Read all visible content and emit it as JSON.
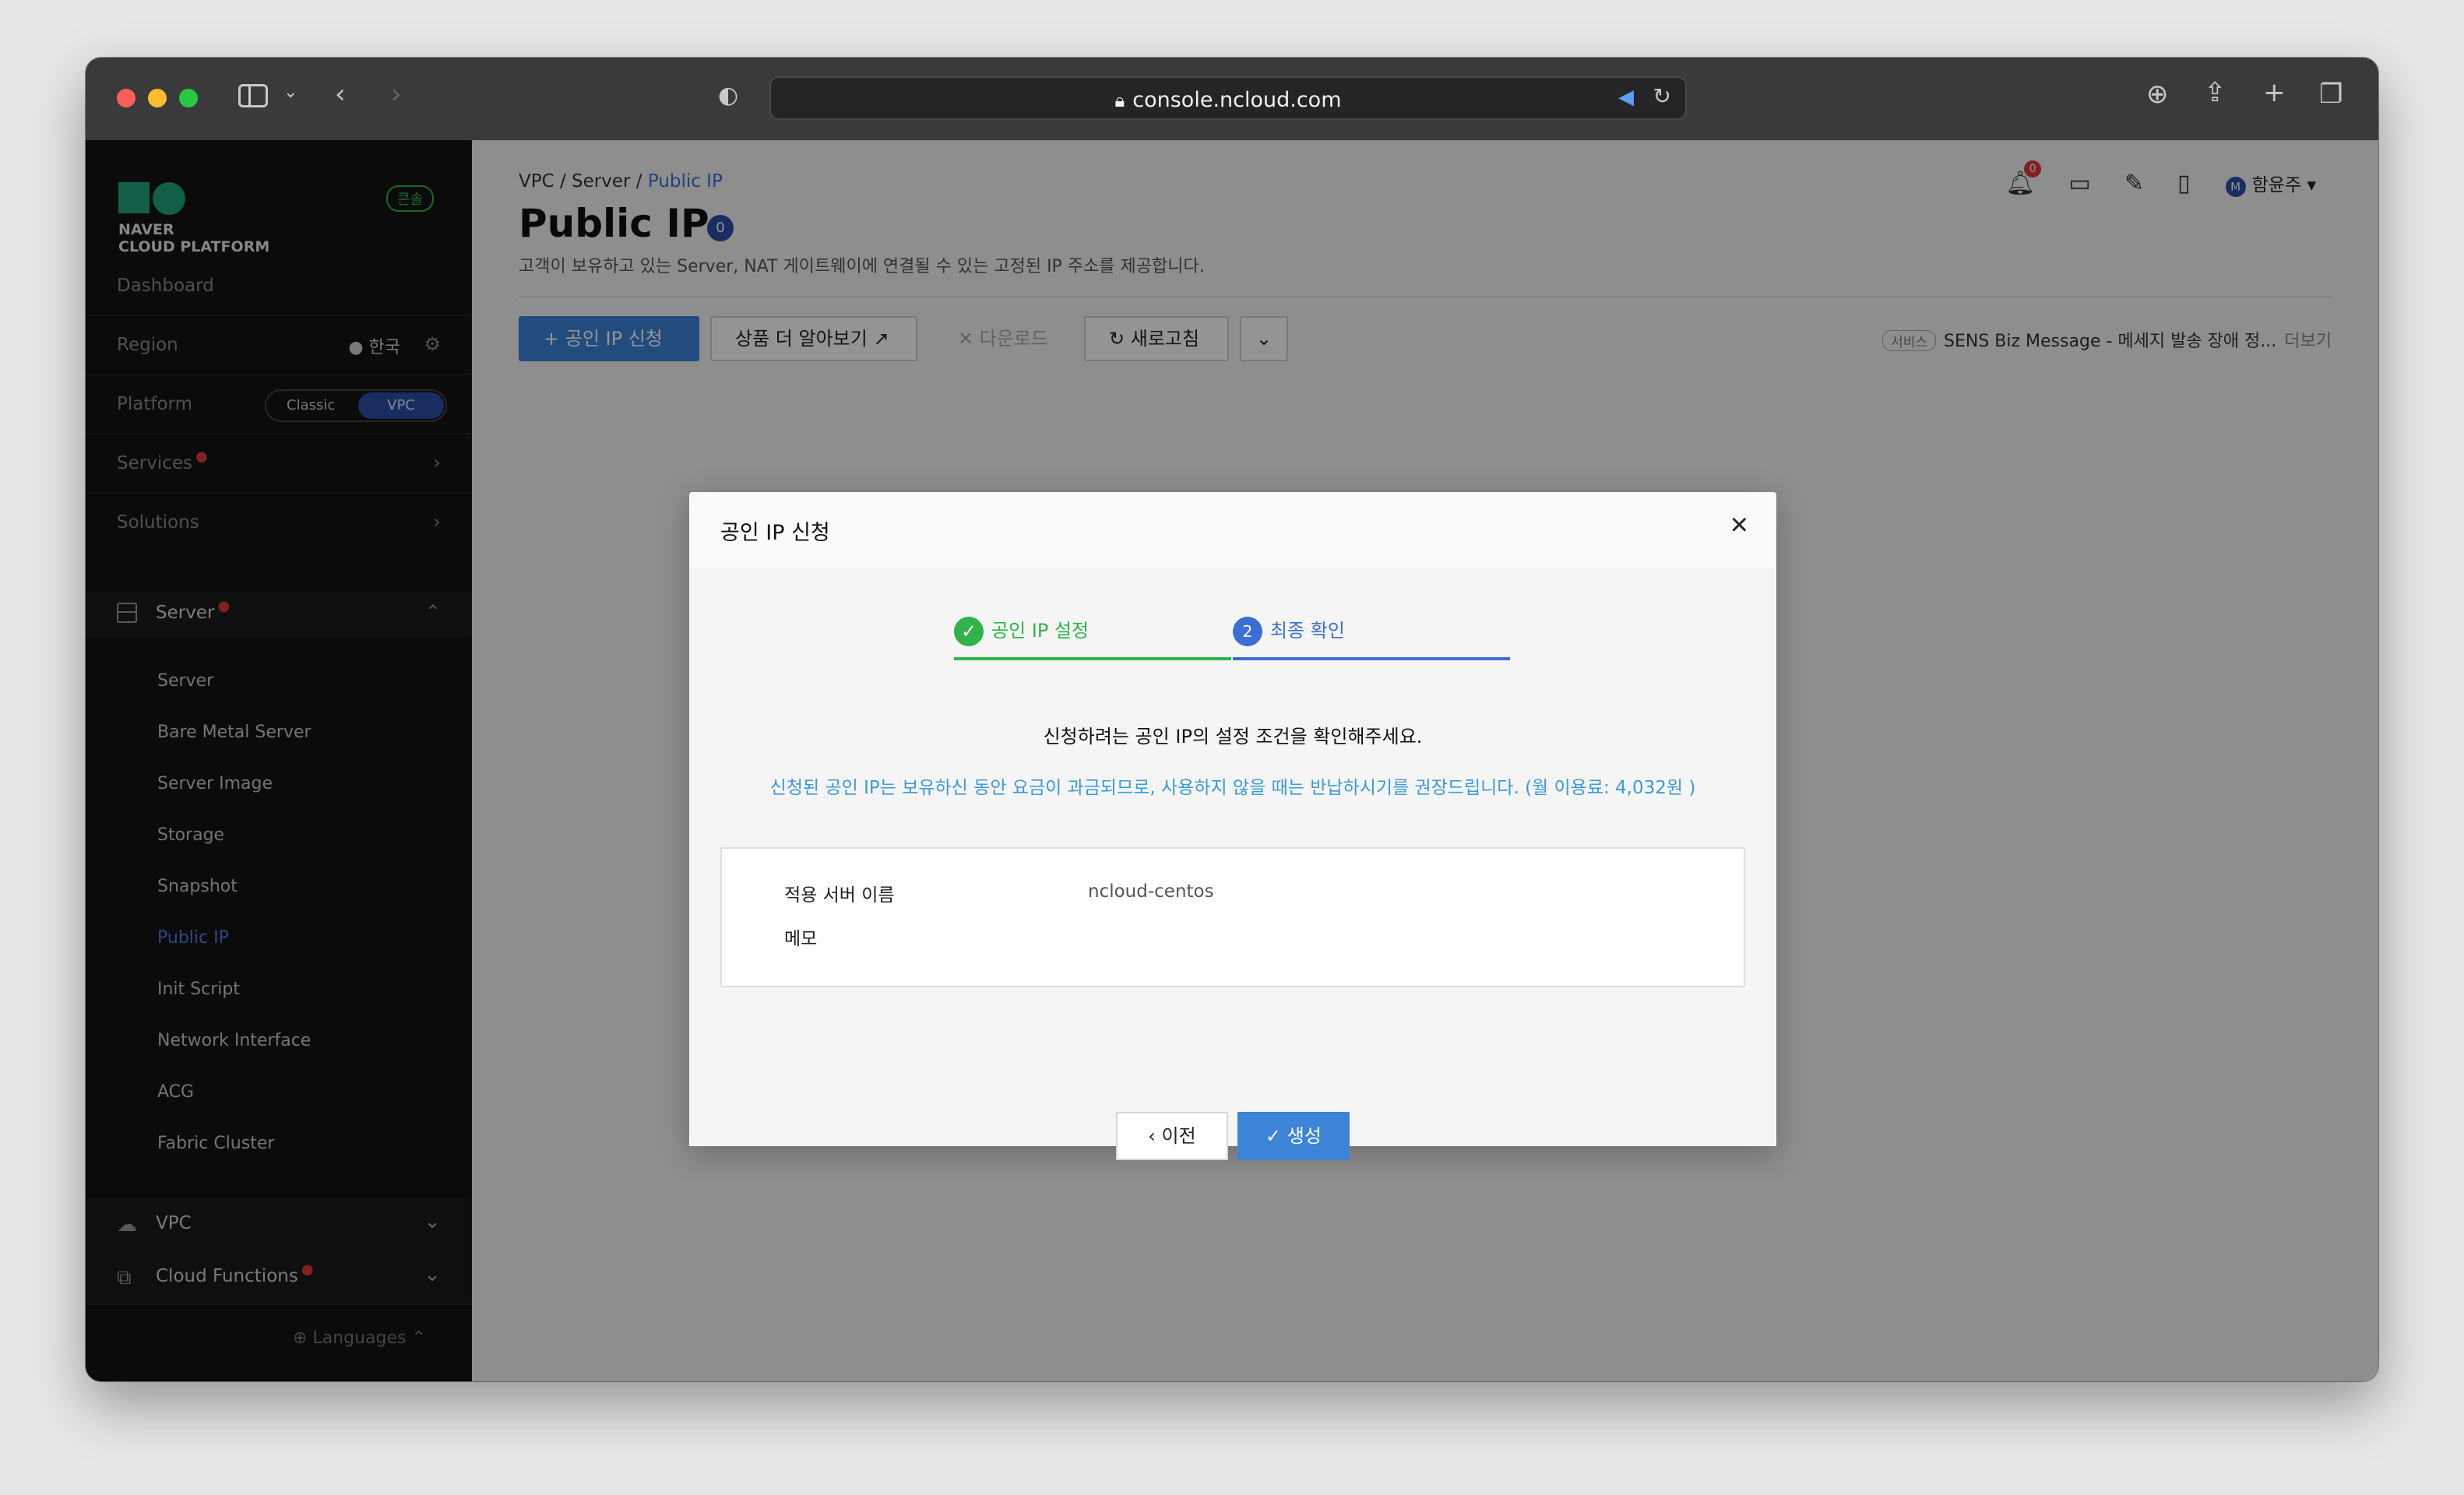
{
  "browser": {
    "url": "console.ncloud.com"
  },
  "sidebar": {
    "logo_line1": "NAVER",
    "logo_line2": "CLOUD PLATFORM",
    "console_badge": "콘솔",
    "dashboard": "Dashboard",
    "region_label": "Region",
    "region_value": "한국",
    "platform_label": "Platform",
    "platform_classic": "Classic",
    "platform_vpc": "VPC",
    "services": "Services",
    "solutions": "Solutions",
    "server_group": "Server",
    "server_items": [
      "Server",
      "Bare Metal Server",
      "Server Image",
      "Storage",
      "Snapshot",
      "Public IP",
      "Init Script",
      "Network Interface",
      "ACG",
      "Fabric Cluster"
    ],
    "vpc_group": "VPC",
    "cloud_functions_group": "Cloud Functions",
    "languages": "Languages"
  },
  "header": {
    "breadcrumb_1": "VPC",
    "breadcrumb_2": "Server",
    "breadcrumb_3": "Public IP",
    "title": "Public IP",
    "count": "0",
    "description": "고객이 보유하고 있는 Server, NAT 게이트웨이에 연결될 수 있는 고정된 IP 주소를 제공합니다.",
    "notification_count": "0",
    "user_initial": "M",
    "user_name": "함윤주"
  },
  "toolbar": {
    "request_label": "공인 IP 신청",
    "learn_more_label": "상품 더 알아보기",
    "download_label": "다운로드",
    "refresh_label": "새로고침"
  },
  "notice": {
    "tag": "서비스",
    "text": "SENS Biz Message - 메세지 발송 장애 정...",
    "more": "더보기"
  },
  "modal": {
    "title": "공인 IP 신청",
    "step1_label": "공인 IP 설정",
    "step2_number": "2",
    "step2_label": "최종 확인",
    "confirm_text": "신청하려는 공인 IP의 설정 조건을 확인해주세요.",
    "info_text": "신청된 공인 IP는 보유하신 동안 요금이 과금되므로, 사용하지 않을 때는 반납하시기를 권장드립니다. (월 이용료: 4,032원 )",
    "field_server_label": "적용 서버 이름",
    "field_server_value": "ncloud-centos",
    "field_memo_label": "메모",
    "prev_label": "이전",
    "create_label": "생성"
  }
}
